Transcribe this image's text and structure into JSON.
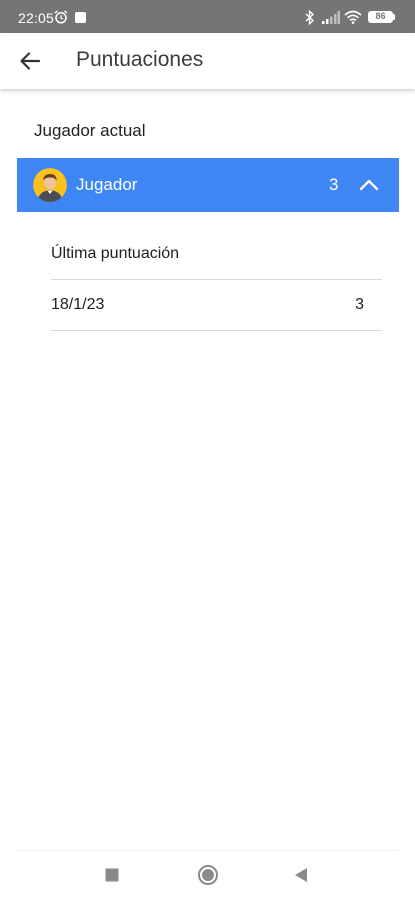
{
  "status_bar": {
    "time": "22:05",
    "battery": "86",
    "icons": [
      "alarm-icon",
      "notification-square-icon",
      "bluetooth-icon",
      "signal-icon",
      "wifi-icon",
      "battery-icon"
    ]
  },
  "app_bar": {
    "back_icon": "arrow-back-icon",
    "title": "Puntuaciones"
  },
  "section": {
    "label": "Jugador actual"
  },
  "player": {
    "avatar_icon": "avatar-icon",
    "name": "Jugador",
    "score": "3",
    "expand_icon": "chevron-up-icon"
  },
  "details": {
    "heading": "Última puntuación",
    "rows": [
      {
        "date": "18/1/23",
        "value": "3"
      }
    ]
  },
  "nav_bar": {
    "icons": [
      "recents-icon",
      "home-icon",
      "back-icon"
    ]
  },
  "colors": {
    "status_bar": "#757575",
    "accent": "#3d86f4",
    "avatar_bg": "#f7c21e",
    "divider": "#dadada"
  }
}
